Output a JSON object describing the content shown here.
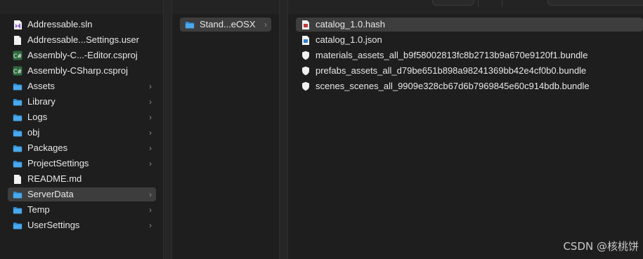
{
  "columns": {
    "col1": [
      {
        "label": "Addressable.sln",
        "icon": "vs-solution-icon"
      },
      {
        "label": "Addressable...Settings.user",
        "icon": "document-icon"
      },
      {
        "label": "Assembly-C...-Editor.csproj",
        "icon": "csharp-project-icon"
      },
      {
        "label": "Assembly-CSharp.csproj",
        "icon": "csharp-project-icon"
      },
      {
        "label": "Assets",
        "icon": "folder-icon",
        "chevron": "›"
      },
      {
        "label": "Library",
        "icon": "folder-icon",
        "chevron": "›"
      },
      {
        "label": "Logs",
        "icon": "folder-icon",
        "chevron": "›"
      },
      {
        "label": "obj",
        "icon": "folder-icon",
        "chevron": "›"
      },
      {
        "label": "Packages",
        "icon": "folder-icon",
        "chevron": "›"
      },
      {
        "label": "ProjectSettings",
        "icon": "folder-icon",
        "chevron": "›"
      },
      {
        "label": "README.md",
        "icon": "document-icon"
      },
      {
        "label": "ServerData",
        "icon": "folder-icon",
        "chevron": "›",
        "selected": true
      },
      {
        "label": "Temp",
        "icon": "folder-icon",
        "chevron": "›"
      },
      {
        "label": "UserSettings",
        "icon": "folder-icon",
        "chevron": "›"
      }
    ],
    "col2": [
      {
        "label": "Stand...eOSX",
        "icon": "folder-icon",
        "chevron": "›",
        "selected": true
      }
    ],
    "col3": [
      {
        "label": "catalog_1.0.hash",
        "icon": "hash-file-icon",
        "selected": true
      },
      {
        "label": "catalog_1.0.json",
        "icon": "json-file-icon"
      },
      {
        "label": "materials_assets_all_b9f58002813fc8b2713b9a670e9120f1.bundle",
        "icon": "bundle-shield-icon"
      },
      {
        "label": "prefabs_assets_all_d79be651b898a98241369bb42e4cf0b0.bundle",
        "icon": "bundle-shield-icon"
      },
      {
        "label": "scenes_scenes_all_9909e328cb67d6b7969845e60c914bdb.bundle",
        "icon": "bundle-shield-icon"
      }
    ]
  },
  "watermark": "CSDN @核桃饼",
  "colors": {
    "background": "#1e1e1e",
    "selection": "#3d3d3d",
    "folder": "#3aa0e8",
    "text": "#e8e8e8"
  }
}
